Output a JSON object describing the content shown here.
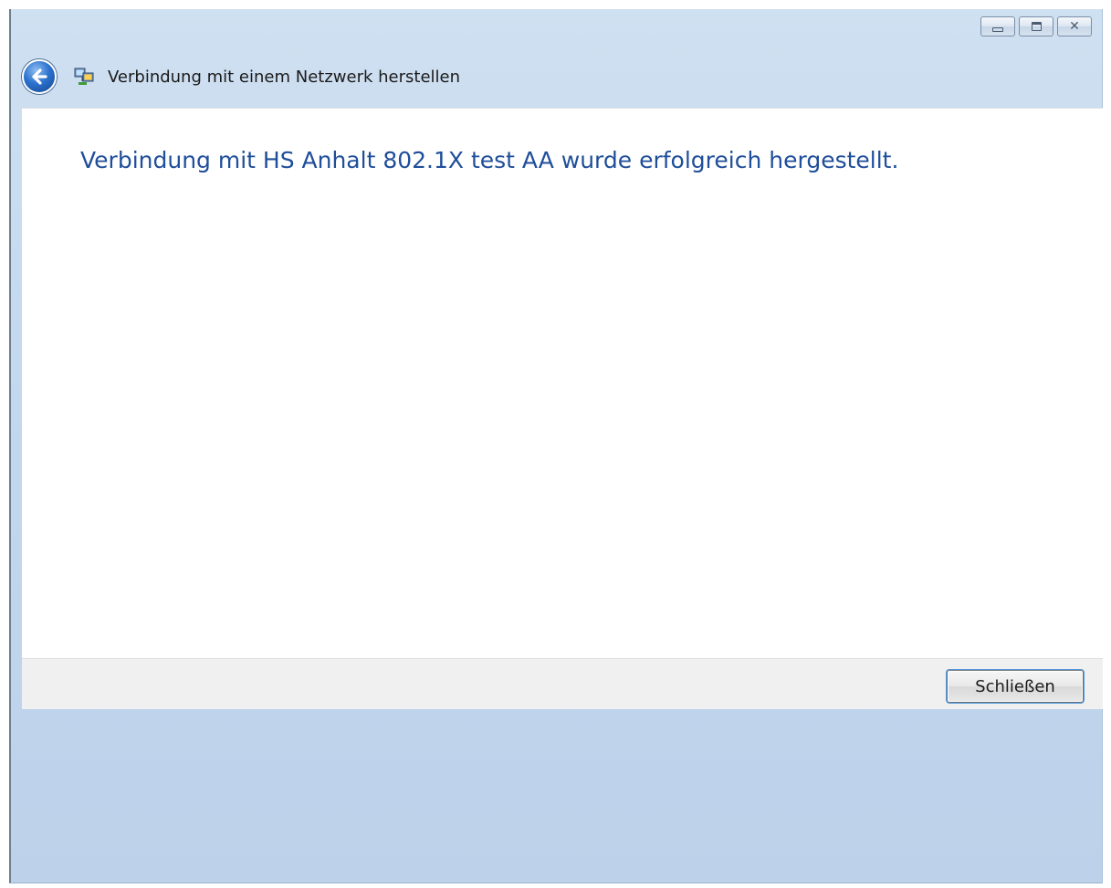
{
  "window": {
    "title": "Verbindung mit einem Netzwerk herstellen",
    "controls": {
      "minimize": "minimize-icon",
      "maximize": "maximize-icon",
      "close_glyph": "✕"
    }
  },
  "content": {
    "headline": "Verbindung mit HS Anhalt 802.1X test AA wurde erfolgreich hergestellt."
  },
  "footer": {
    "close_button_label": "Schließen"
  },
  "colors": {
    "headline": "#1f4e9a",
    "frame": "#c3d7ee",
    "footer": "#f0f0f0"
  }
}
